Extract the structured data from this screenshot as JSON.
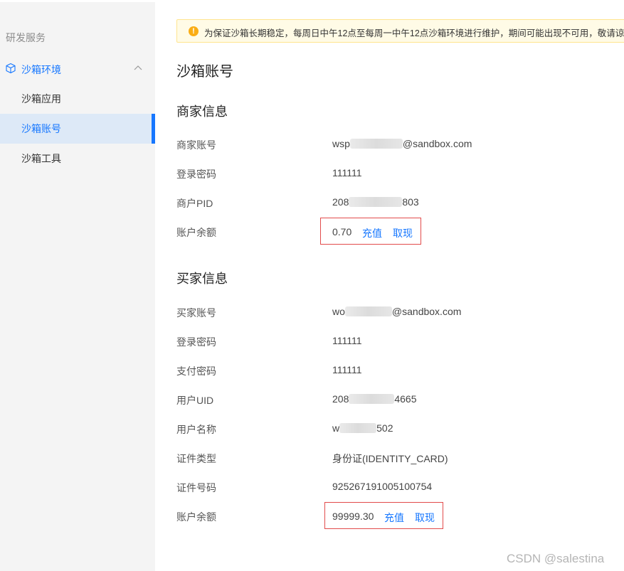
{
  "sidebar": {
    "section_title": "研发服务",
    "group_label": "沙箱环境",
    "items": [
      {
        "label": "沙箱应用"
      },
      {
        "label": "沙箱账号"
      },
      {
        "label": "沙箱工具"
      }
    ]
  },
  "notice": {
    "text": "为保证沙箱长期稳定，每周日中午12点至每周一中午12点沙箱环境进行维护，期间可能出现不可用，敬请谅解。"
  },
  "page_title": "沙箱账号",
  "merchant": {
    "title": "商家信息",
    "account_label": "商家账号",
    "account_prefix": "wsp",
    "account_suffix": "@sandbox.com",
    "password_label": "登录密码",
    "password": "111111",
    "pid_label": "商户PID",
    "pid_prefix": "208",
    "pid_suffix": "803",
    "balance_label": "账户余额",
    "balance": "0.70",
    "recharge": "充值",
    "withdraw": "取现"
  },
  "buyer": {
    "title": "买家信息",
    "account_label": "买家账号",
    "account_prefix": "wo",
    "account_suffix": "@sandbox.com",
    "password_label": "登录密码",
    "password": "111111",
    "pay_password_label": "支付密码",
    "pay_password": "111111",
    "uid_label": "用户UID",
    "uid_prefix": "208",
    "uid_suffix": "4665",
    "name_label": "用户名称",
    "name_prefix": "w",
    "name_suffix": "502",
    "id_type_label": "证件类型",
    "id_type": "身份证(IDENTITY_CARD)",
    "id_number_label": "证件号码",
    "id_number": "925267191005100754",
    "balance_label": "账户余额",
    "balance": "99999.30",
    "recharge": "充值",
    "withdraw": "取现"
  },
  "watermark": "CSDN @salestina",
  "colors": {
    "accent": "#1677ff",
    "highlight_border": "#e24b4b",
    "notice_bg": "#fffbe6"
  }
}
